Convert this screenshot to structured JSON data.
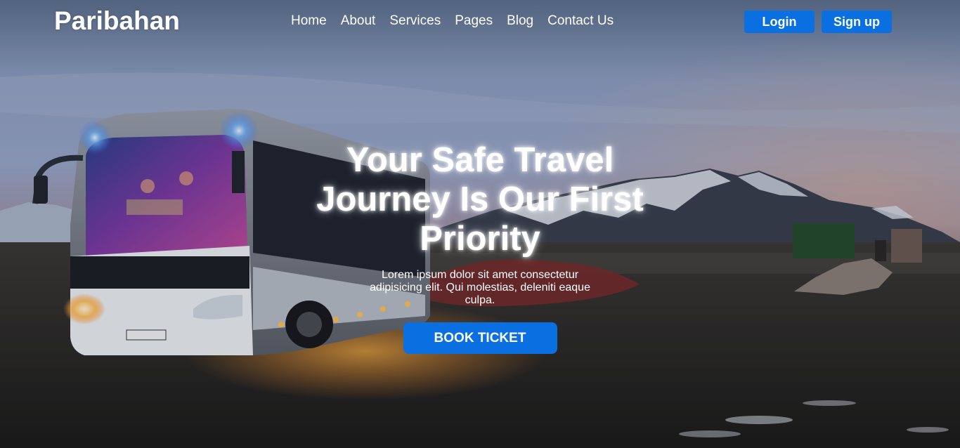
{
  "brand": {
    "name": "Paribahan"
  },
  "nav": {
    "items": [
      {
        "label": "Home"
      },
      {
        "label": "About"
      },
      {
        "label": "Services"
      },
      {
        "label": "Pages"
      },
      {
        "label": "Blog"
      },
      {
        "label": "Contact Us"
      }
    ]
  },
  "auth": {
    "login_label": "Login",
    "signup_label": "Sign up"
  },
  "hero": {
    "headline": "Your Safe Travel Journey Is Our First Priority",
    "description": "Lorem ipsum dolor sit amet consectetur adipisicing elit. Qui molestias, deleniti eaque culpa.",
    "cta_label": "BOOK TICKET",
    "background": "bus-at-dusk-mountain-photo"
  },
  "colors": {
    "accent": "#0a6fe0",
    "text": "#ffffff"
  }
}
